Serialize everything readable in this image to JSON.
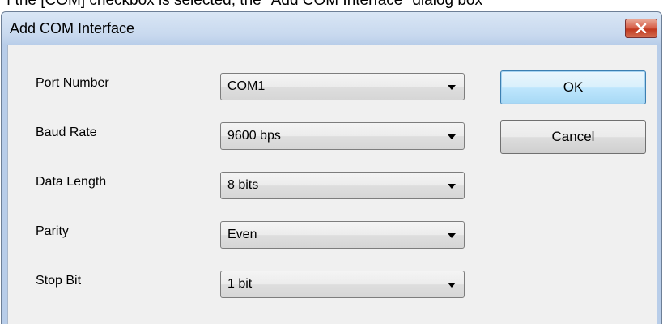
{
  "background_text": "f the [COM] checkbox is selected, the \"Add COM Interface\" dialog box",
  "window": {
    "title": "Add COM Interface",
    "close_icon": "close-x-icon"
  },
  "fields": [
    {
      "label": "Port Number",
      "value": "COM1"
    },
    {
      "label": "Baud Rate",
      "value": "9600 bps"
    },
    {
      "label": "Data Length",
      "value": "8 bits"
    },
    {
      "label": "Parity",
      "value": "Even"
    },
    {
      "label": "Stop Bit",
      "value": "1 bit"
    }
  ],
  "buttons": {
    "ok": "OK",
    "cancel": "Cancel"
  },
  "colors": {
    "title_gradient_top": "#d9e6f5",
    "client_background": "#f0f0f0",
    "close_button": "#c1391f",
    "default_button_border": "#3c7fb1"
  }
}
